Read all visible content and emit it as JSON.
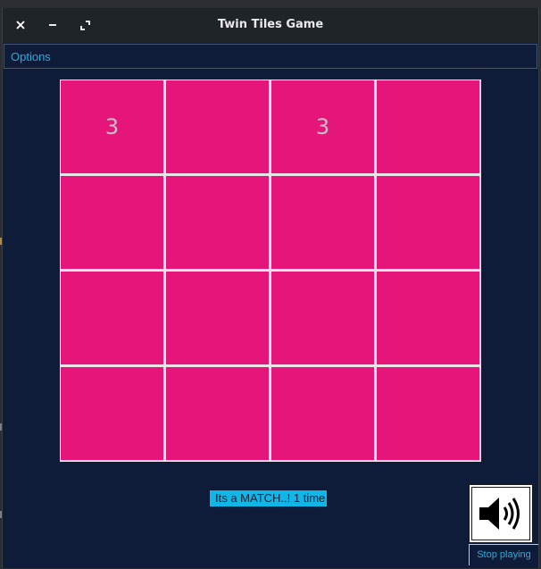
{
  "window": {
    "title": "Twin Tiles Game"
  },
  "titlebar": {
    "close_icon": "close-icon",
    "minimize_icon": "minimize-icon",
    "maximize_icon": "maximize-icon"
  },
  "menu": {
    "options_label": "Options"
  },
  "board": {
    "rows": 4,
    "cols": 4,
    "tile_color": "#e6157a",
    "tiles": [
      "3",
      "",
      "3",
      "",
      "",
      "",
      "",
      "",
      "",
      "",
      "",
      "",
      "",
      "",
      "",
      ""
    ]
  },
  "status": {
    "message": "Its a MATCH..! 1 time"
  },
  "sound": {
    "icon": "speaker-volume-icon",
    "stop_label": "Stop playing"
  },
  "colors": {
    "background": "#0f1c39",
    "accent": "#22aee0",
    "status_bg": "#12b6e6"
  }
}
